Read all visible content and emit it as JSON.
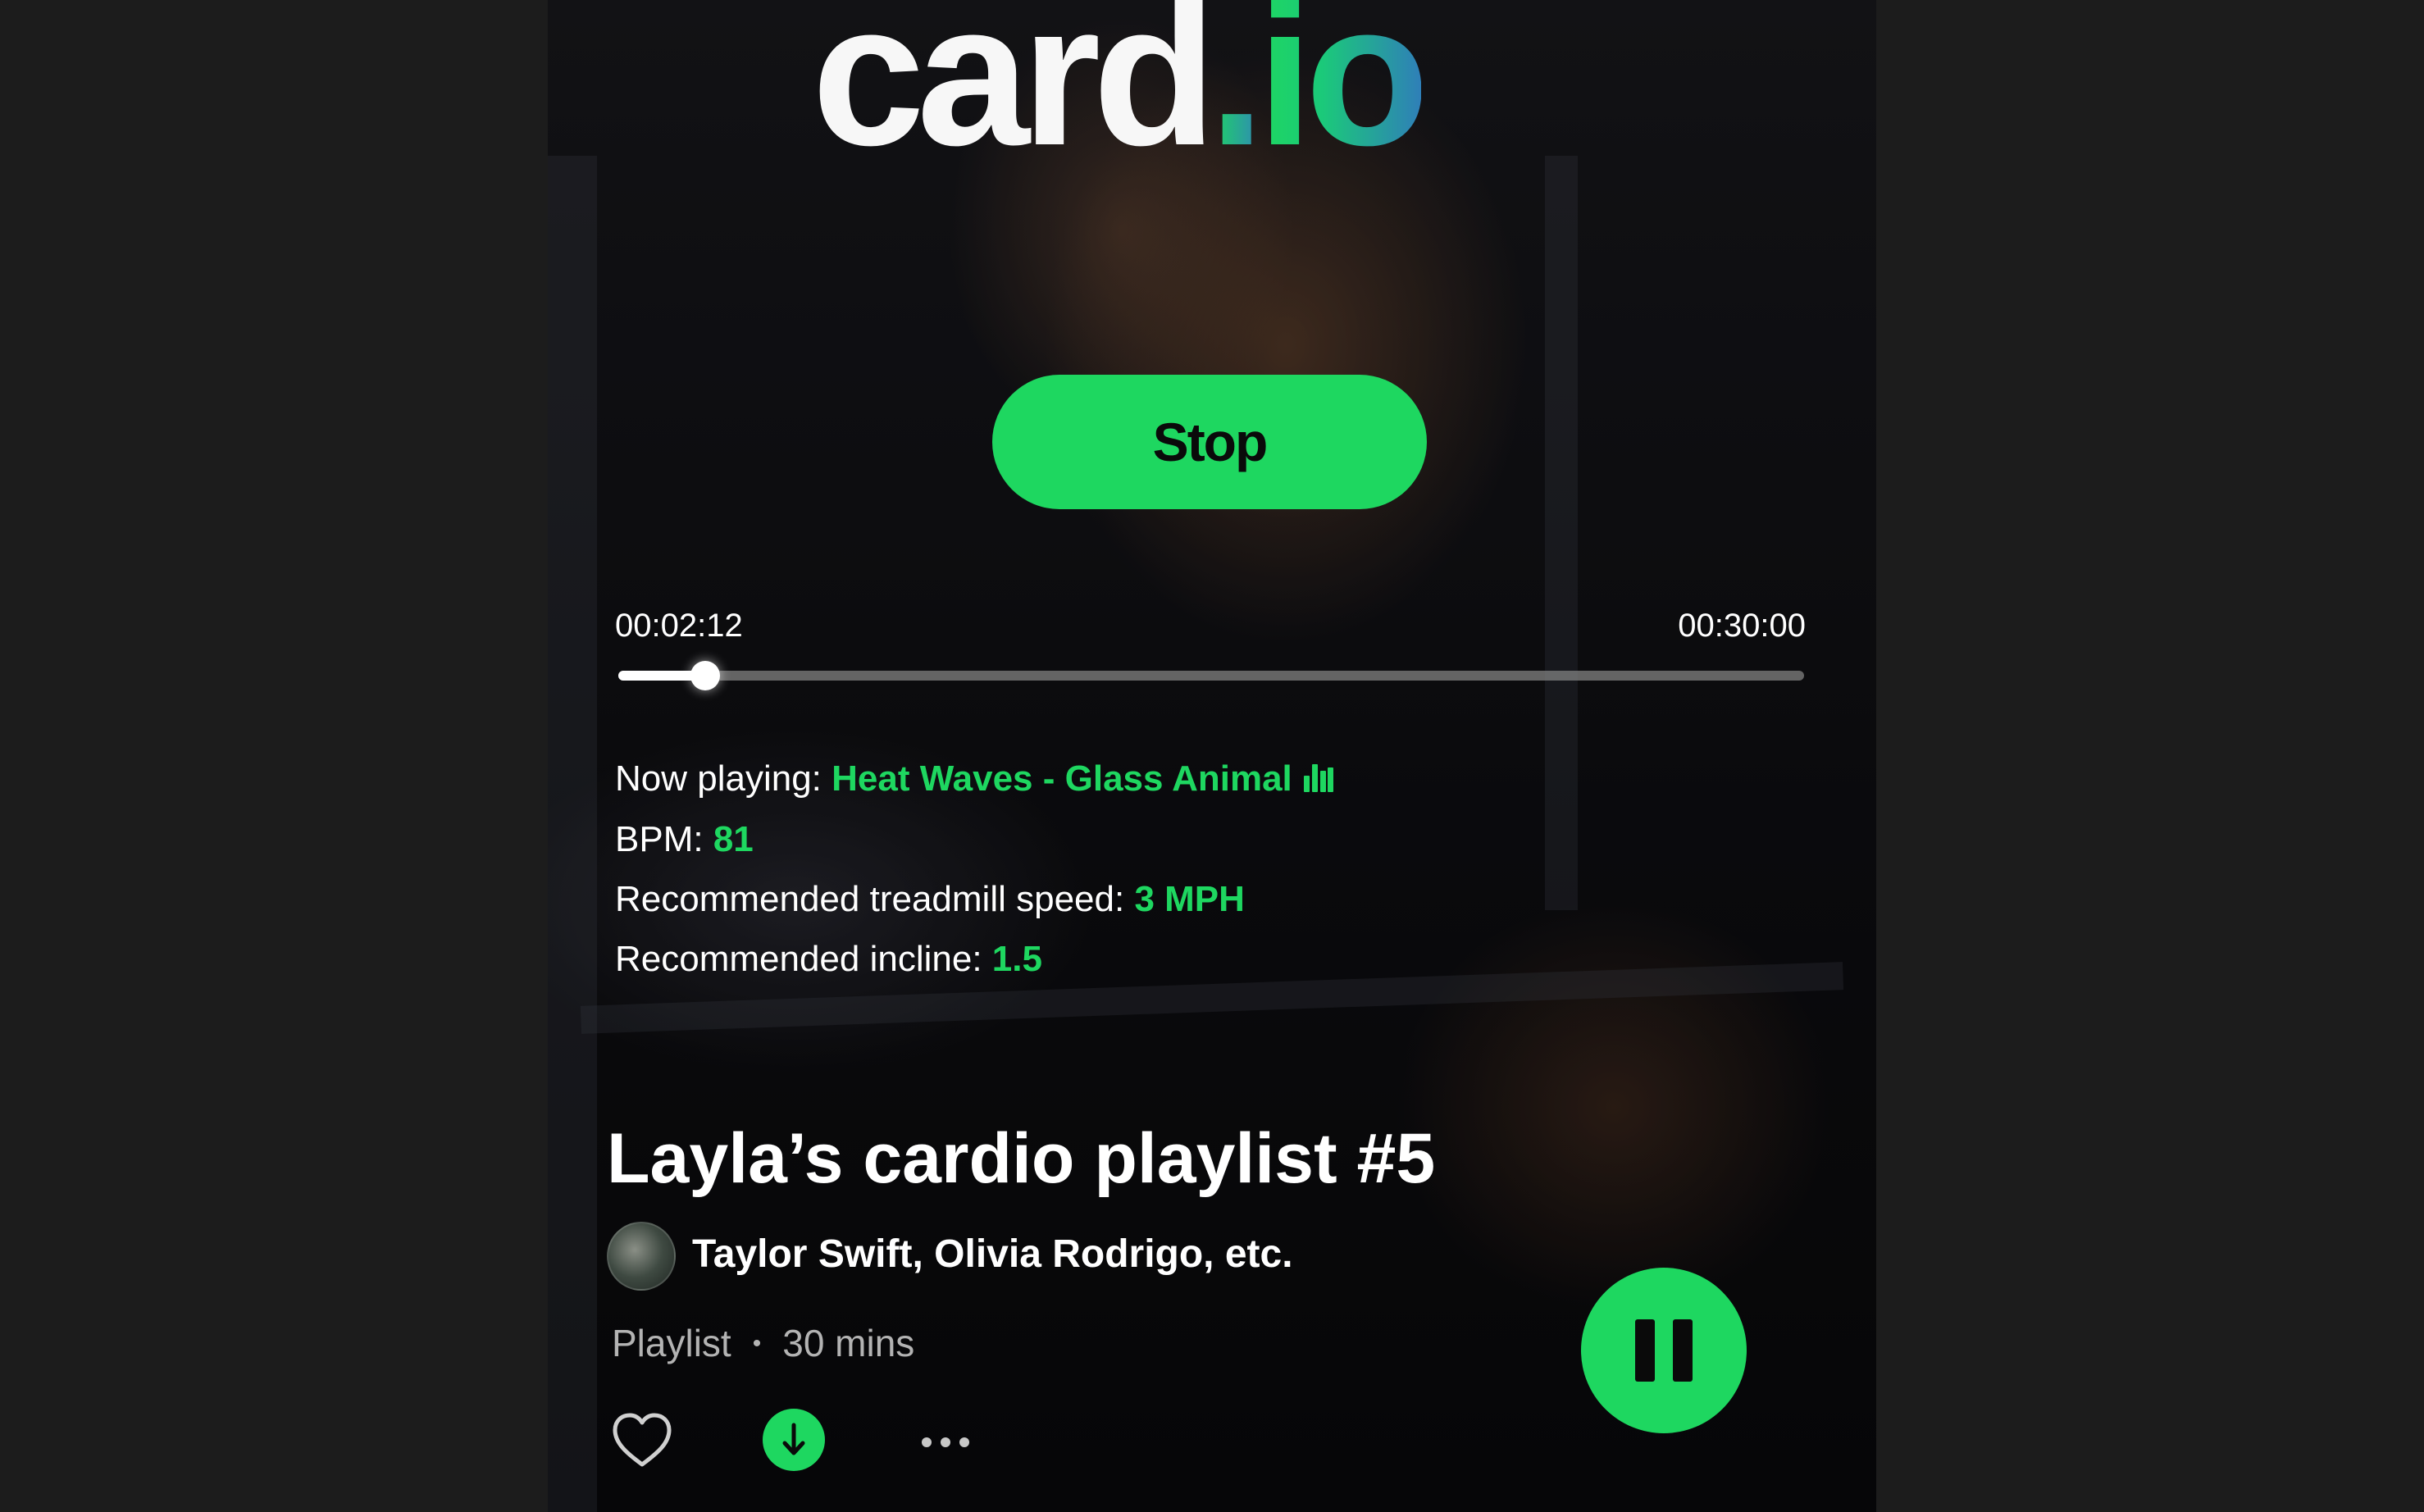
{
  "app": {
    "logo_main": "card",
    "logo_dot": ".",
    "logo_suffix": "io"
  },
  "workout": {
    "stop_label": "Stop",
    "elapsed": "00:02:12",
    "total": "00:30:00",
    "progress_fraction": 0.0733
  },
  "now_playing": {
    "label": "Now playing:",
    "track": "Heat Waves - Glass Animal",
    "icon": "equalizer-bars-icon"
  },
  "bpm": {
    "label": "BPM:",
    "value": "81"
  },
  "speed": {
    "label": "Recommended treadmill speed:",
    "value": "3 MPH"
  },
  "incline": {
    "label": "Recommended incline:",
    "value": "1.5"
  },
  "playlist": {
    "title": "Layla’s cardio playlist #5",
    "artists": "Taylor Swift, Olivia Rodrigo, etc.",
    "type": "Playlist",
    "separator": "•",
    "duration": "30 mins",
    "icons": [
      "heart-icon",
      "download-icon",
      "more-icon",
      "pause-icon"
    ]
  },
  "colors": {
    "accent": "#1ed760",
    "gradient_end": "#2f7fb8",
    "background": "#1c1c1c"
  }
}
